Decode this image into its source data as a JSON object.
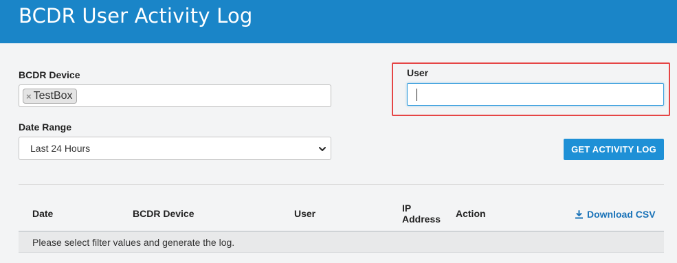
{
  "header": {
    "title": "BCDR User Activity Log"
  },
  "filters": {
    "device_label": "BCDR Device",
    "device_chips": [
      {
        "label": "TestBox"
      }
    ],
    "date_range_label": "Date Range",
    "date_range_value": "Last 24 Hours",
    "user_label": "User",
    "user_value": "",
    "get_log_button": "GET ACTIVITY LOG"
  },
  "table": {
    "columns": [
      "Date",
      "BCDR Device",
      "User",
      "IP Address",
      "Action"
    ],
    "column_ip_line1": "IP",
    "column_ip_line2": "Address",
    "download_label": "Download CSV",
    "empty_message": "Please select filter values and generate the log."
  },
  "colors": {
    "header_bg": "#1a85c8",
    "button_bg": "#1e90d6",
    "highlight_border": "#e54545",
    "link": "#1a73b8"
  },
  "icons": {
    "chip_remove": "close-icon",
    "select": "chevron-down-icon",
    "download": "download-icon"
  }
}
